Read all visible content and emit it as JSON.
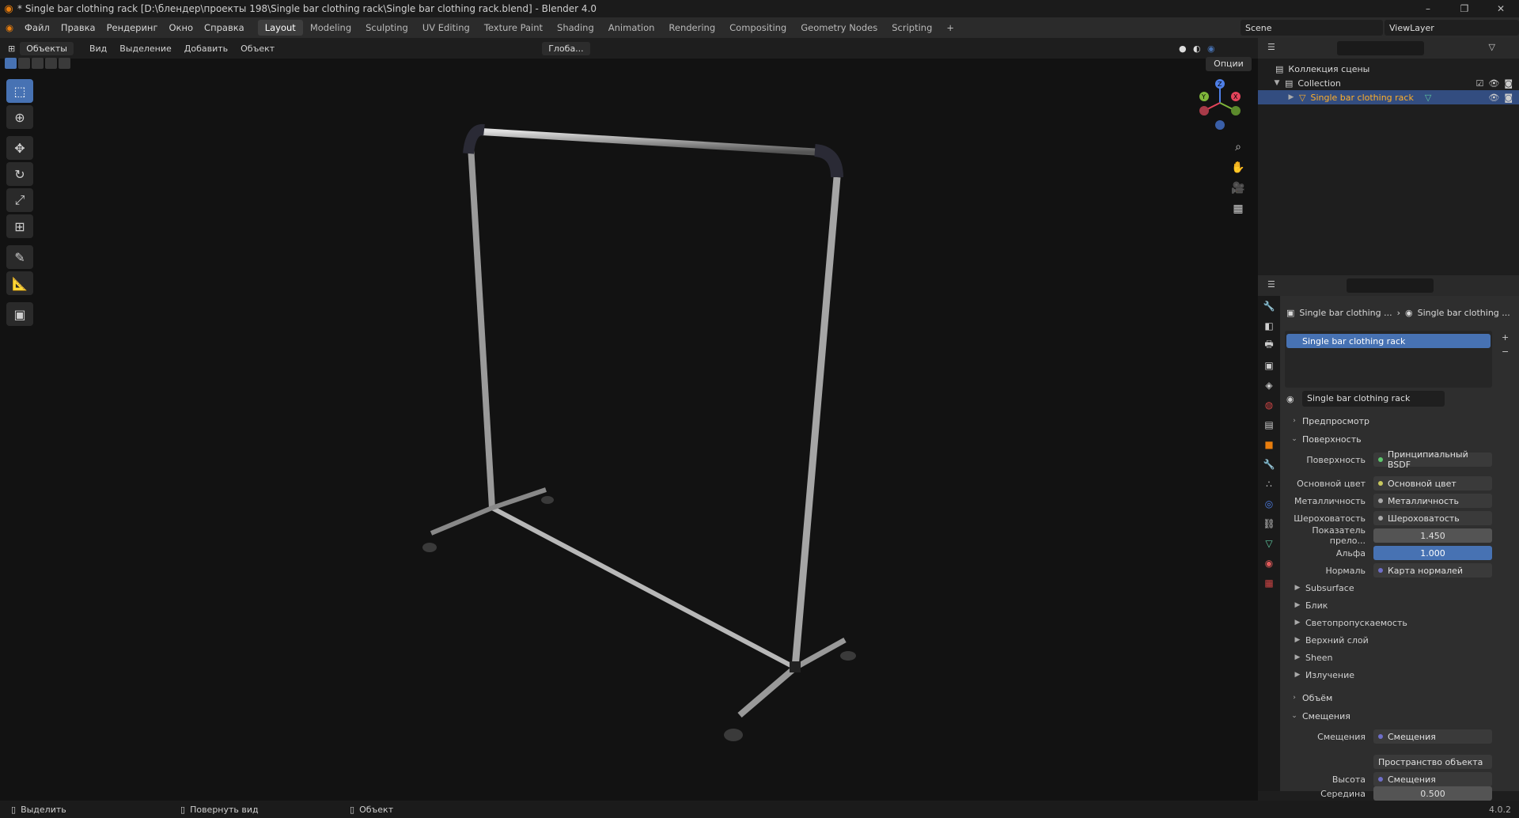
{
  "titlebar": {
    "title": "* Single bar clothing rack [D:\\блендер\\проекты 198\\Single bar clothing rack\\Single bar clothing rack.blend] - Blender 4.0",
    "min": "–",
    "max": "❐",
    "close": "✕"
  },
  "menu": [
    "Файл",
    "Правка",
    "Рендеринг",
    "Окно",
    "Справка"
  ],
  "workspaces": [
    "Layout",
    "Modeling",
    "Sculpting",
    "UV Editing",
    "Texture Paint",
    "Shading",
    "Animation",
    "Rendering",
    "Compositing",
    "Geometry Nodes",
    "Scripting",
    "+"
  ],
  "scene": "Scene",
  "viewlayer": "ViewLayer",
  "viewport_header": {
    "mode": "Объекты",
    "menus": [
      "Вид",
      "Выделение",
      "Добавить",
      "Объект"
    ],
    "transform": "Глоба..."
  },
  "options_label": "Опции",
  "outliner": {
    "root": "Коллекция сцены",
    "collection": "Collection",
    "object": "Single bar clothing rack"
  },
  "properties": {
    "crumb1": "Single bar clothing ...",
    "crumb2": "Single bar clothing ...",
    "slot": "Single bar clothing rack",
    "material": "Single bar clothing rack",
    "panels": {
      "preview": "Предпросмотр",
      "surface": "Поверхность",
      "volume": "Объём",
      "displacement": "Смещения"
    },
    "surface_label": "Поверхность",
    "surface_value": "Принципиальный BSDF",
    "base_color_label": "Основной цвет",
    "base_color_value": "Основной цвет",
    "metallic_label": "Металличность",
    "metallic_value": "Металличность",
    "roughness_label": "Шероховатость",
    "roughness_value": "Шероховатость",
    "ior_label": "Показатель прело...",
    "ior_value": "1.450",
    "alpha_label": "Альфа",
    "alpha_value": "1.000",
    "normal_label": "Нормаль",
    "normal_value": "Карта нормалей",
    "subpanels": [
      "Subsurface",
      "Блик",
      "Светопропускаемость",
      "Верхний слой",
      "Sheen",
      "Излучение"
    ],
    "disp_label": "Смещения",
    "disp_value": "Смещения",
    "space_value": "Пространство объекта",
    "height_label": "Высота",
    "height_value": "Смещения",
    "mid_label": "Середина",
    "mid_value": "0.500"
  },
  "status": {
    "select": "Выделить",
    "rotate": "Повернуть вид",
    "object": "Объект",
    "version": "4.0.2"
  },
  "colors": {
    "accent": "#4772b3",
    "object_text": "#ffaf29",
    "blender_orange": "#e87d0d"
  }
}
